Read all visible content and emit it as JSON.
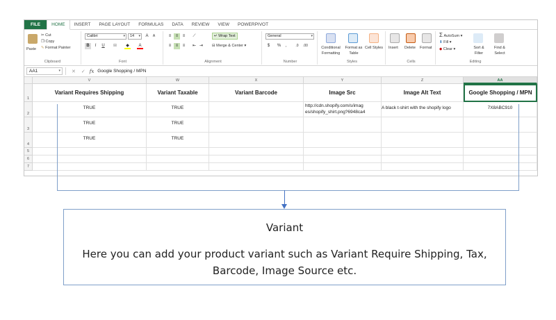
{
  "tabs": [
    "FILE",
    "HOME",
    "INSERT",
    "PAGE LAYOUT",
    "FORMULAS",
    "DATA",
    "REVIEW",
    "VIEW",
    "POWERPIVOT"
  ],
  "ribbon": {
    "clipboard": {
      "paste": "Paste",
      "cut": "Cut",
      "copy": "Copy",
      "format_painter": "Format Painter",
      "label": "Clipboard"
    },
    "font": {
      "name": "Calibri",
      "size": "14",
      "grow": "A",
      "shrink": "A",
      "bold": "B",
      "italic": "I",
      "underline": "U",
      "label": "Font"
    },
    "alignment": {
      "wrap_text": "Wrap Text",
      "merge_center": "Merge & Center",
      "label": "Alignment"
    },
    "number": {
      "format": "General",
      "currency": "$",
      "percent": "%",
      "comma": ",",
      "label": "Number"
    },
    "styles": {
      "conditional": "Conditional Formatting",
      "format_table": "Format as Table",
      "cell_styles": "Cell Styles",
      "label": "Styles"
    },
    "cells": {
      "insert": "Insert",
      "delete": "Delete",
      "format": "Format",
      "label": "Cells"
    },
    "editing": {
      "autosum": "AutoSum",
      "fill": "Fill",
      "clear": "Clear",
      "sort_filter": "Sort & Filter",
      "find_select": "Find & Select",
      "label": "Editing"
    }
  },
  "formula_bar": {
    "name_box": "AA1",
    "fx": "fx",
    "value": "Google Shopping / MPN"
  },
  "columns": [
    "V",
    "W",
    "X",
    "Y",
    "Z",
    "AA"
  ],
  "rows": [
    "1",
    "2",
    "3",
    "4",
    "5",
    "6",
    "7"
  ],
  "headers": [
    "Variant Requires Shipping",
    "Variant Taxable",
    "Variant Barcode",
    "Image Src",
    "Image Alt Text",
    "Google Shopping / MPN"
  ],
  "data_rows": [
    [
      "TRUE",
      "TRUE",
      "",
      "http://cdn.shopify.com/s/imag",
      "A black t-shirt with the shopify logo",
      "7X8ABC910"
    ],
    [
      "TRUE",
      "TRUE",
      "",
      "",
      "",
      ""
    ],
    [
      "TRUE",
      "TRUE",
      "",
      "",
      "",
      ""
    ]
  ],
  "image_src_line2": "es/shopify_shirt.png?6948ca4",
  "callout": {
    "title": "Variant",
    "description": "Here you can add your product variant such as Variant Require Shipping, Tax, Barcode, Image Source etc."
  },
  "colors": {
    "excel_green": "#217346",
    "callout_border": "#7f9fc9",
    "arrow": "#4472c4"
  }
}
